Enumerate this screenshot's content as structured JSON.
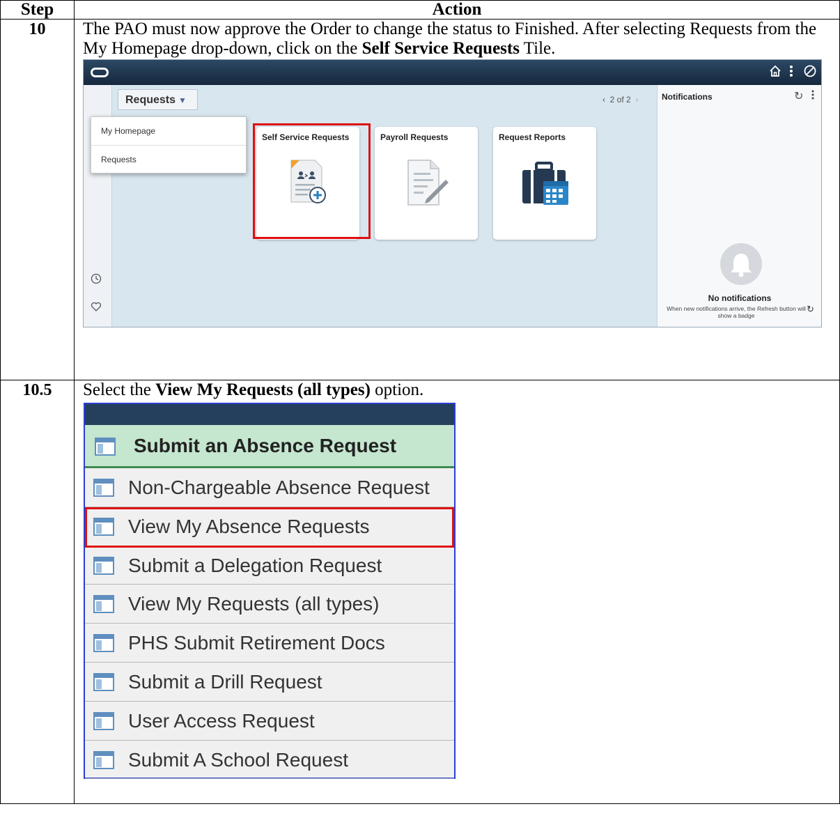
{
  "table": {
    "col_step": "Step",
    "col_action": "Action"
  },
  "rows": [
    {
      "step": "10",
      "text_before": "The PAO must now approve the Order to change the status to Finished. After selecting Requests from the My Homepage drop-down, click on the ",
      "text_bold": "Self Service Requests",
      "text_after": " Tile."
    },
    {
      "step": "10.5",
      "text_before": "Select the ",
      "text_bold": "View My Requests (all types)",
      "text_after": " option."
    }
  ],
  "screenshot1": {
    "requests_button": "Requests",
    "pager": "2 of 2",
    "dropdown": [
      "My Homepage",
      "Requests"
    ],
    "tiles": [
      "Self Service Requests",
      "Payroll Requests",
      "Request Reports"
    ],
    "notifications_title": "Notifications",
    "no_notifications": "No notifications",
    "no_notifications_sub": "When new notifications arrive, the Refresh button will show a badge"
  },
  "screenshot2": {
    "header": "Submit an Absence Request",
    "items": [
      "Non-Chargeable Absence Request",
      "View My Absence Requests",
      "Submit a Delegation Request",
      "View My Requests (all types)",
      "PHS Submit Retirement Docs",
      "Submit a Drill Request",
      "User Access Request",
      "Submit A School Request"
    ]
  },
  "colors": {
    "highlight": "#e01010",
    "banner": "#1e3650",
    "menu_header_bg": "#c5e6cf",
    "menu_border": "#2b3fd0"
  }
}
